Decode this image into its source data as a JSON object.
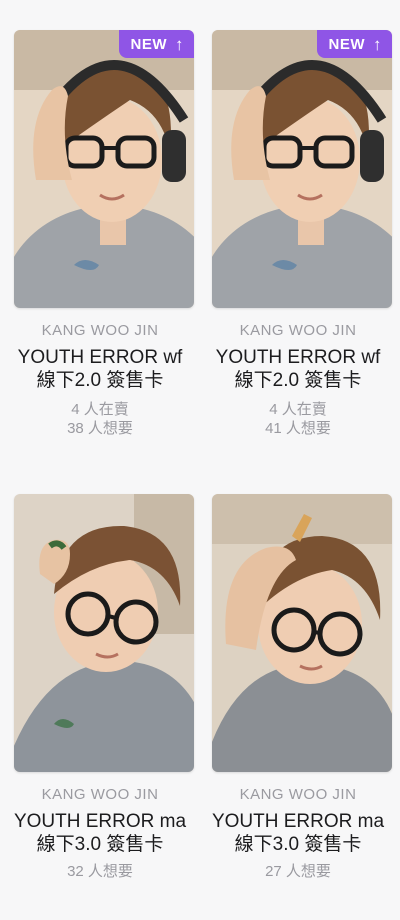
{
  "badge": {
    "label": "NEW",
    "icon": "arrow-up-icon",
    "color": "#8f55e6"
  },
  "cards": [
    {
      "artist": "KANG WOO JIN",
      "title_line1": "YOUTH ERROR wf",
      "title_line2": "線下2.0 簽售卡",
      "selling": "4 人在賣",
      "wanting": "38 人想要",
      "is_new": true
    },
    {
      "artist": "KANG WOO JIN",
      "title_line1": "YOUTH ERROR wf",
      "title_line2": "線下2.0 簽售卡",
      "selling": "4 人在賣",
      "wanting": "41 人想要",
      "is_new": true
    },
    {
      "artist": "KANG WOO JIN",
      "title_line1": "YOUTH ERROR ma",
      "title_line2": "線下3.0 簽售卡",
      "wanting": "32 人想要",
      "is_new": false
    },
    {
      "artist": "KANG WOO JIN",
      "title_line1": "YOUTH ERROR ma",
      "title_line2": "線下3.0 簽售卡",
      "wanting": "27 人想要",
      "is_new": false
    }
  ]
}
